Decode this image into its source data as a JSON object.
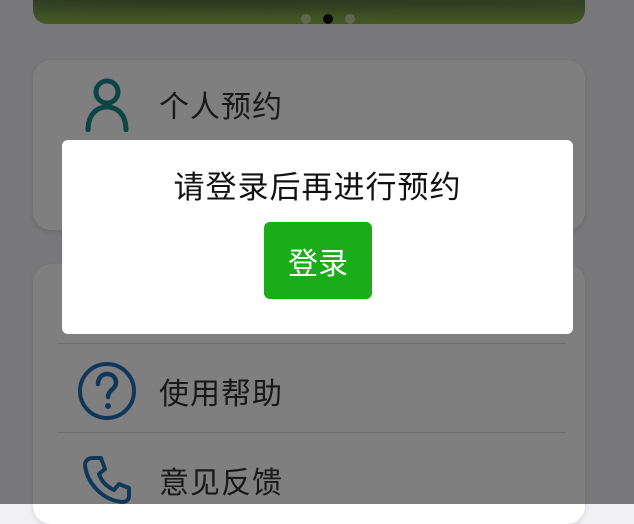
{
  "menu": {
    "items": [
      {
        "label": "个人预约",
        "icon": "person-icon"
      },
      {
        "label": "使用帮助",
        "icon": "help-icon"
      },
      {
        "label": "意见反馈",
        "icon": "phone-icon"
      }
    ]
  },
  "dialog": {
    "message": "请登录后再进行预约",
    "login_label": "登录"
  },
  "colors": {
    "accent_green": "#1aad19",
    "icon_teal": "#1b8b8f",
    "icon_blue": "#1f6fb5"
  }
}
